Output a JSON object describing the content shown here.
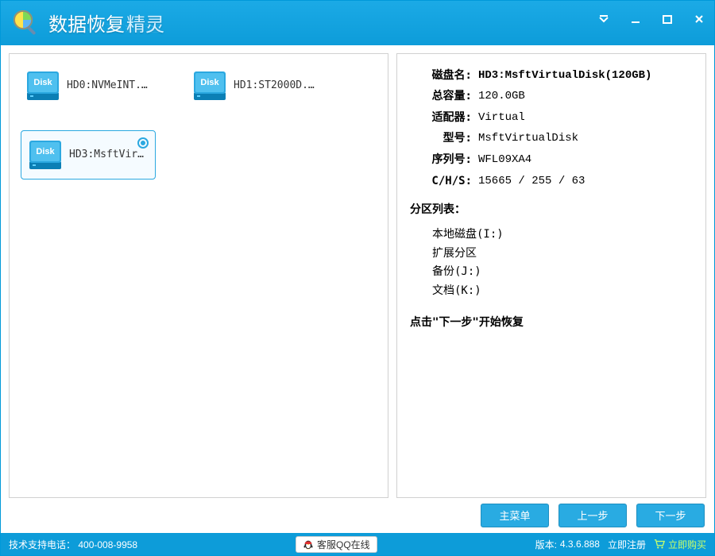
{
  "app": {
    "title_part1": "数据恢复",
    "title_part2": "精灵"
  },
  "disks": [
    {
      "label": "HD0:NVMeINT...",
      "selected": false
    },
    {
      "label": "HD1:ST2000D...",
      "selected": false
    },
    {
      "label": "HD3:MsftVir...",
      "selected": true
    }
  ],
  "details": {
    "name_label": "磁盘名:",
    "name_value": "HD3:MsftVirtualDisk(120GB)",
    "capacity_label": "总容量:",
    "capacity_value": "120.0GB",
    "adapter_label": "适配器:",
    "adapter_value": "Virtual",
    "model_label": "型号:",
    "model_value": "MsftVirtualDisk",
    "serial_label": "序列号:",
    "serial_value": "WFL09XA4",
    "chs_label": "C/H/S:",
    "chs_value": "15665 / 255 / 63",
    "partitions_header": "分区列表：",
    "partitions": [
      "本地磁盘(I:)",
      "扩展分区",
      "备份(J:)",
      "文档(K:)"
    ],
    "hint": "点击\"下一步\"开始恢复"
  },
  "buttons": {
    "main_menu": "主菜单",
    "prev": "上一步",
    "next": "下一步"
  },
  "status": {
    "support_label": "技术支持电话：",
    "support_phone": "400-008-9958",
    "qq_label": "客服QQ在线",
    "version_label": "版本:",
    "version_value": "4.3.6.888",
    "register": "立即注册",
    "buy": "立即购买"
  }
}
